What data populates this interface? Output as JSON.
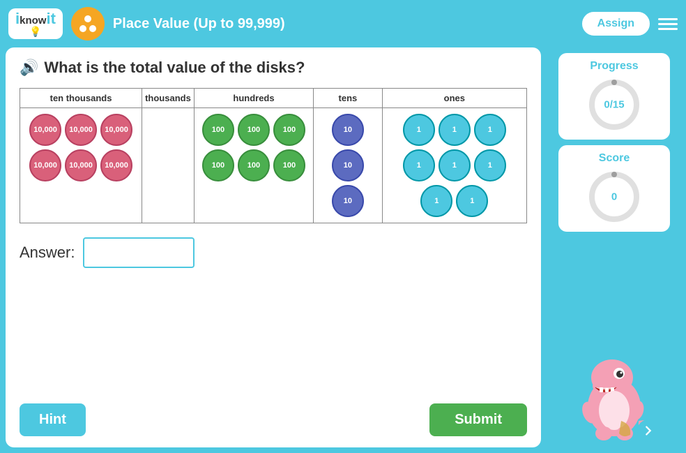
{
  "header": {
    "logo_i": "i",
    "logo_know": "know",
    "logo_it": "it",
    "activity_title": "Place Value (Up to 99,999)",
    "assign_label": "Assign",
    "menu_aria": "Menu"
  },
  "question": {
    "text": "What is the total value of the disks?",
    "speaker_icon": "speaker-icon"
  },
  "table": {
    "headers": [
      "ten thousands",
      "thousands",
      "hundreds",
      "tens",
      "ones"
    ],
    "ten_thousands_disks": [
      "10,000",
      "10,000",
      "10,000",
      "10,000",
      "10,000",
      "10,000"
    ],
    "thousands_disks": [],
    "hundreds_disks": [
      "100",
      "100",
      "100",
      "100",
      "100",
      "100"
    ],
    "tens_disks": [
      "10",
      "10",
      "10"
    ],
    "ones_disks": [
      "1",
      "1",
      "1",
      "1",
      "1",
      "1",
      "1",
      "1"
    ]
  },
  "answer": {
    "label": "Answer:",
    "placeholder": ""
  },
  "buttons": {
    "hint_label": "Hint",
    "submit_label": "Submit"
  },
  "progress": {
    "label": "Progress",
    "value": "0/15",
    "percent": 0
  },
  "score": {
    "label": "Score",
    "value": "0"
  },
  "nav": {
    "arrow_icon": "right-arrow-icon"
  }
}
